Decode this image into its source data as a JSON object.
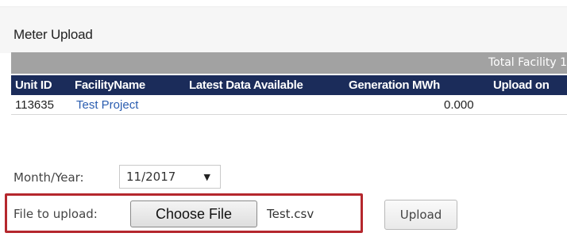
{
  "page": {
    "title": "Meter Upload"
  },
  "summary": {
    "text": "Total Facility 1"
  },
  "table": {
    "columns": [
      "Unit ID",
      "FacilityName",
      "Latest Data Available",
      "Generation MWh",
      "Upload on"
    ],
    "rows": [
      {
        "unit_id": "113635",
        "facility_name": "Test Project",
        "latest_data": "",
        "generation_mwh": "0.000",
        "upload_on": ""
      }
    ]
  },
  "form": {
    "month_year_label": "Month/Year:",
    "month_year_value": "11/2017",
    "file_label": "File to upload:",
    "choose_file_label": "Choose File",
    "selected_file": "Test.csv",
    "upload_label": "Upload"
  },
  "colors": {
    "header_bg": "#1b2c5a",
    "summary_bg": "#a2a2a2",
    "link": "#2a5db0",
    "highlight": "#b5272d"
  },
  "icons": {
    "dropdown": "caret-down-icon"
  }
}
